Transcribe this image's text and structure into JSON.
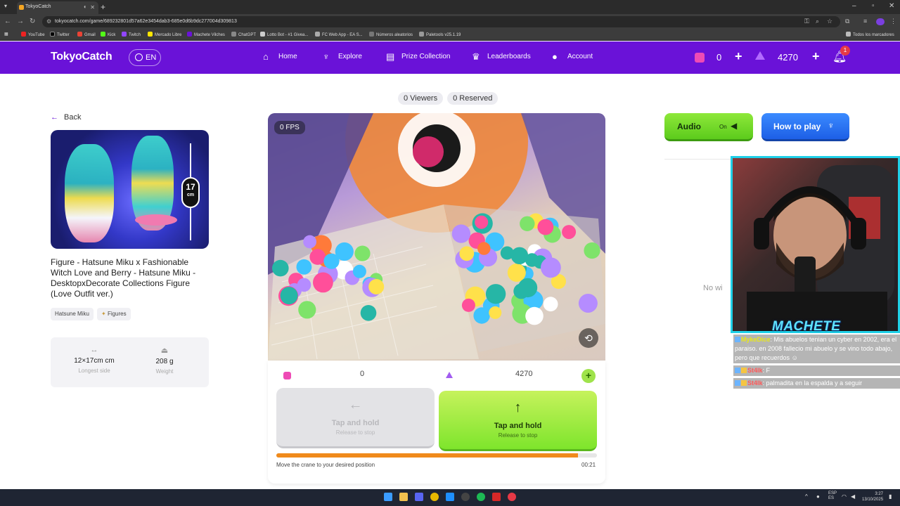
{
  "browser": {
    "tab_title": "TokyoCatch",
    "url": "tokyocatch.com/game/689232801d57a62e3454dab3-685e0d6b9dc277004d309813",
    "bookmarks": [
      "YouTube",
      "Twitter",
      "Gmail",
      "Kick",
      "Twitch",
      "Mercado Libre",
      "Machete Vilches",
      "ChatGPT",
      "Lotto Bot - #1 Givea...",
      "FC Web App - EA S...",
      "Números aleatorios",
      "Paletools v25.1.19"
    ],
    "all_bookmarks": "Todos los marcadores"
  },
  "nav": {
    "logo": "TokyoCatch",
    "lang": "EN",
    "items": [
      "Home",
      "Explore",
      "Prize Collection",
      "Leaderboards",
      "Account"
    ],
    "tickets": "0",
    "gems": "4270",
    "notifications": "1"
  },
  "page": {
    "viewers": "0 Viewers",
    "reserved": "0 Reserved",
    "back": "Back",
    "size_value": "17",
    "size_unit": "cm",
    "prize_title": "Figure - Hatsune Miku x Fashionable Witch Love and Berry - Hatsune Miku - DesktopxDecorate Collections Figure (Love Outfit ver.)",
    "tags": [
      "Hatsune Miku",
      "Figures"
    ],
    "specs": {
      "dimensions": "12×17cm cm",
      "dimensions_label": "Longest side",
      "weight": "208 g",
      "weight_label": "Weight"
    }
  },
  "game": {
    "fps": "0 FPS",
    "tickets": "0",
    "gems": "4270",
    "btn_left_label": "Tap and hold",
    "btn_left_sub": "Release to stop",
    "btn_up_label": "Tap and hold",
    "btn_up_sub": "Release to stop",
    "progress": 0.94,
    "hint": "Move the crane to your desired position",
    "timer": "00:21"
  },
  "side": {
    "audio_label": "Audio",
    "audio_state": "On",
    "howto_label": "How to play",
    "no_wins": "No wi"
  },
  "overlay": {
    "streamer_name": "MACHETE",
    "chat": [
      {
        "user": "MykeDice",
        "text": ": Mis abuelos tenian un cyber en 2002, era el paraiso. en 2008 fallecio mi abuelo y se vino todo abajo, pero que recuerdos"
      },
      {
        "user": "St4lk",
        "text": ": F"
      },
      {
        "user": "St4lk",
        "text": ": palmadita en la espalda y a seguir"
      }
    ]
  },
  "taskbar": {
    "lang1": "ESP",
    "lang2": "ES",
    "time": "3:27",
    "date": "13/10/2025"
  },
  "colors": {
    "brand_purple": "#6a12d8",
    "accent_green": "#7ee52c",
    "accent_blue": "#1d5fe6",
    "progress_orange": "#f08a1c"
  }
}
